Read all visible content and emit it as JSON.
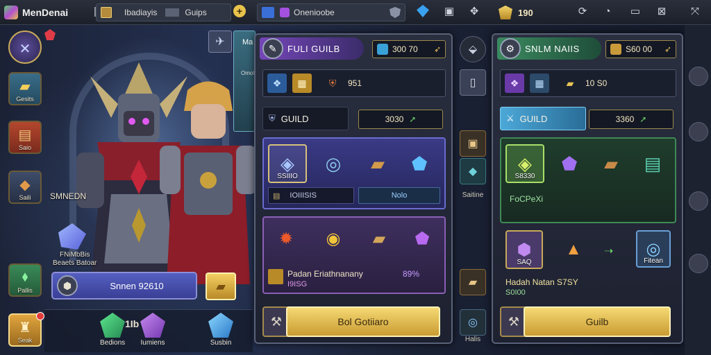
{
  "topbar": {
    "app_title": "MenDenai",
    "tab1": "Ibadiayis",
    "tab2": "Guips",
    "tab3": "Onenioobe",
    "currency": "190",
    "icons": [
      "app-logo-icon",
      "chest-icon",
      "plus-icon",
      "window-icon",
      "gem-icon",
      "shield-icon",
      "stop-icon",
      "puzzle-icon",
      "gold-crest-icon",
      "refresh-icon",
      "wifi-icon",
      "screen-icon",
      "close-icon",
      "expand-icon"
    ]
  },
  "left": {
    "side_buttons": [
      {
        "label": "Gesits"
      },
      {
        "label": "Saio"
      },
      {
        "label": "Saili"
      },
      {
        "label": "Pallis"
      },
      {
        "label": "Seak"
      }
    ],
    "hero_name": "SMNEDN",
    "fragment_label_1": "FNiMbBis",
    "fragment_label_2": "Beaets Batoar",
    "summon_text": "Snnen 92610",
    "bottom_items": [
      {
        "label": "Bedions"
      },
      {
        "label": "Iumiens"
      },
      {
        "label": "Susbin"
      }
    ],
    "bottom_count": "1Ib"
  },
  "panel1": {
    "title": "FULI GUILB",
    "cost": "300 70",
    "row2_value": "951",
    "guild_label": "GUILD",
    "guild_value": "3030",
    "selected_item_tag": "SSIIIO",
    "foot_left": "IOIIISIS",
    "foot_right": "Nolo",
    "reward_line": "Padan Eriathnanany",
    "reward_sub": "I9ISG",
    "reward_pct": "89%",
    "button": "Bol Gotiiaro",
    "colors": {
      "accent": "#7446b8",
      "button": "#e8c456"
    }
  },
  "panel2": {
    "title": "SNLM NAIIS",
    "cost": "S60 00",
    "row2_value": "10 S0",
    "guild_label": "GUILD",
    "guild_value": "3360",
    "selected_item_tag": "S8330",
    "sub_label": "FoCPeXi",
    "reward_tag": "SAQ",
    "reward_tag2": "Fitean",
    "reward_line": "Hadah Natan S7SY",
    "reward_sub": "S0I00",
    "button": "Guilb",
    "colors": {
      "accent": "#3b8a60",
      "tab": "#4ca8d8"
    }
  },
  "middle": {
    "label_top": "Ma",
    "label_2": "Omol",
    "label_3": "Saitine",
    "label_bottom": "Halis"
  }
}
